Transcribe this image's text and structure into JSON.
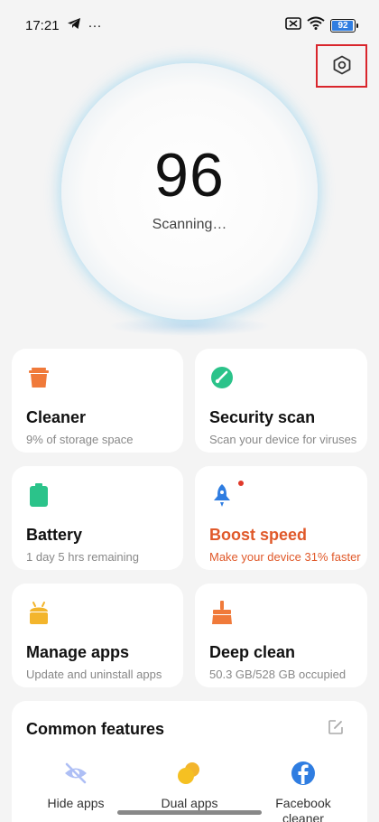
{
  "status_bar": {
    "time": "17:21",
    "dots": "···",
    "battery_level": "92"
  },
  "scanner": {
    "score": "96",
    "status": "Scanning…",
    "ring_color": "#1aa7e6"
  },
  "cards": [
    {
      "title": "Cleaner",
      "subtitle": "9% of storage space",
      "icon": "trash-icon",
      "color": "#f07a3a"
    },
    {
      "title": "Security scan",
      "subtitle": "Scan your device for viruses",
      "icon": "shield-check-icon",
      "color": "#2bc38a"
    },
    {
      "title": "Battery",
      "subtitle": "1 day 5 hrs  remaining",
      "icon": "battery-icon",
      "color": "#2bc38a"
    },
    {
      "title": "Boost speed",
      "subtitle": "Make your device 31% faster",
      "icon": "rocket-icon",
      "color": "#2f7de1",
      "alert_color": "#e0592a"
    },
    {
      "title": "Manage apps",
      "subtitle": "Update and uninstall apps",
      "icon": "android-app-icon",
      "color": "#f3b52c"
    },
    {
      "title": "Deep clean",
      "subtitle": "50.3 GB/528 GB occupied",
      "icon": "broom-icon",
      "color": "#f07a3a"
    }
  ],
  "common_features": {
    "title": "Common features",
    "items": [
      {
        "label": "Hide apps",
        "icon": "eye-off-icon"
      },
      {
        "label": "Dual apps",
        "icon": "dual-circles-icon"
      },
      {
        "label": "Facebook cleaner",
        "icon": "facebook-icon"
      }
    ]
  }
}
